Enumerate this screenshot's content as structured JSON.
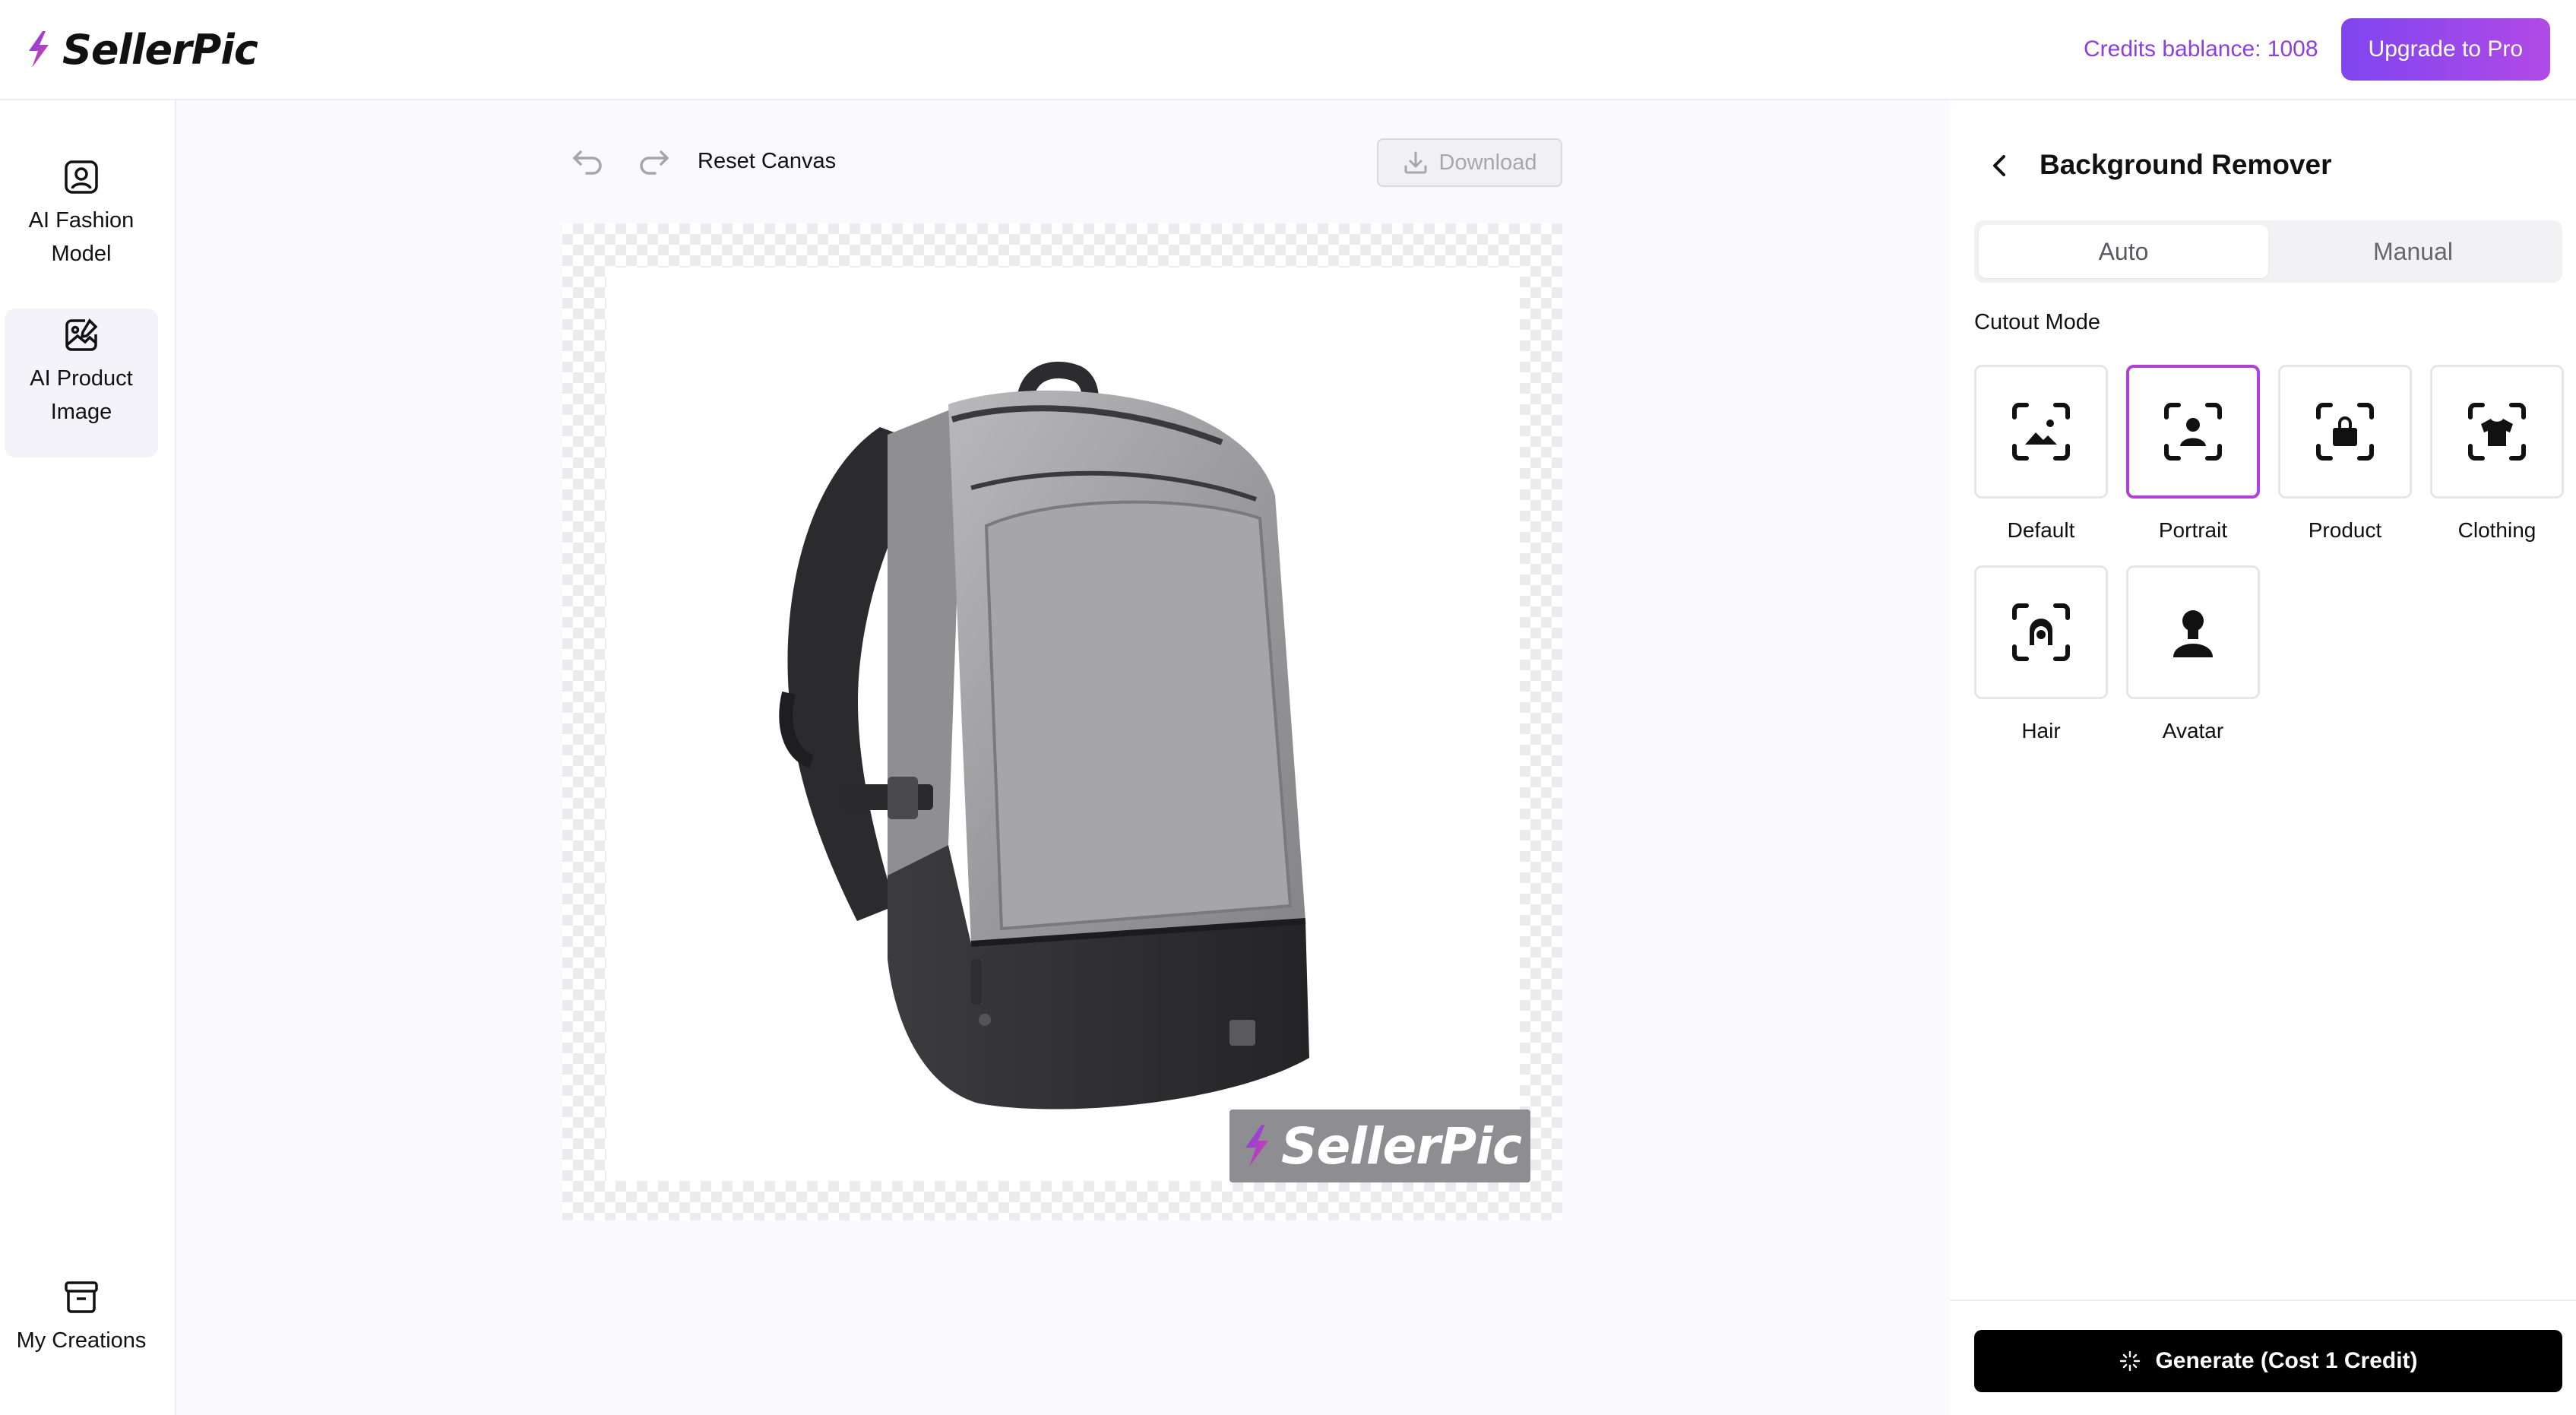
{
  "app": {
    "name": "SellerPic"
  },
  "header": {
    "credits_text": "Credits bablance: 1008",
    "upgrade_label": "Upgrade to Pro"
  },
  "sidebar": {
    "items": [
      {
        "label": "AI Fashion Model",
        "icon": "user-portrait-icon",
        "active": false
      },
      {
        "label": "AI Product Image",
        "icon": "image-edit-icon",
        "active": true
      }
    ],
    "bottom": {
      "label": "My Creations",
      "icon": "archive-box-icon"
    }
  },
  "toolbar": {
    "undo_icon": "undo-icon",
    "redo_icon": "redo-icon",
    "reset_label": "Reset Canvas",
    "download_label": "Download",
    "download_enabled": false
  },
  "canvas": {
    "image_subject": "grey backpack product photo",
    "watermark_text": "SellerPic"
  },
  "panel": {
    "title": "Background Remover",
    "tabs": [
      {
        "label": "Auto",
        "active": true
      },
      {
        "label": "Manual",
        "active": false
      }
    ],
    "cutout_mode_label": "Cutout Mode",
    "modes": [
      {
        "label": "Default",
        "icon": "scan-landscape-icon",
        "selected": false
      },
      {
        "label": "Portrait",
        "icon": "scan-person-icon",
        "selected": true
      },
      {
        "label": "Product",
        "icon": "scan-bag-icon",
        "selected": false
      },
      {
        "label": "Clothing",
        "icon": "scan-shirt-icon",
        "selected": false
      },
      {
        "label": "Hair",
        "icon": "scan-hair-icon",
        "selected": false
      },
      {
        "label": "Avatar",
        "icon": "person-silhouette-icon",
        "selected": false
      }
    ],
    "generate_label": "Generate (Cost 1 Credit)"
  },
  "colors": {
    "brand_purple": "#8a3fe0",
    "upgrade_gradient_start": "#7f45ef",
    "upgrade_gradient_end": "#b14ae6",
    "selected_border": "#b23fd6",
    "generate_bg": "#000000"
  }
}
